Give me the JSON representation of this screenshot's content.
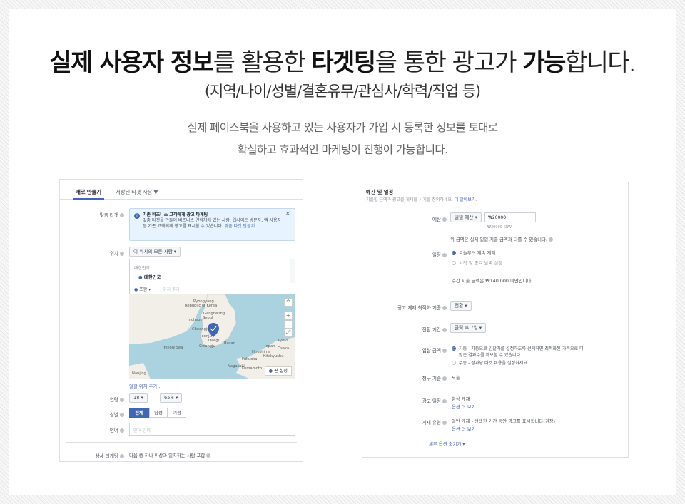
{
  "hero": {
    "headline": [
      {
        "text": "실제 사용자 정보",
        "bold": true
      },
      {
        "text": "를 활용한 ",
        "bold": false
      },
      {
        "text": "타겟팅",
        "bold": true
      },
      {
        "text": "을 통한 광고가 ",
        "bold": false
      },
      {
        "text": "가능",
        "bold": true
      },
      {
        "text": "합니다.",
        "bold": false
      }
    ],
    "subheadline": "(지역/나이/성별/결혼유무/관심사/학력/직업 등)",
    "description_line1": "실제 페이스북을 사용하고 있는 사용자가 가입 시 등록한 정보를 토대로",
    "description_line2": "확실하고 효과적인 마케팅이 진행이 가능합니다."
  },
  "left_panel": {
    "tab_new": "새로 만들기",
    "tab_saved": "저장된 타겟 사용 ▼",
    "custom_target_label": "맞춤 타겟",
    "info_title": "기존 비즈니스 고객에게 광고 타게팅",
    "info_body": "맞춤 타겟을 만들어 비즈니스 연락처에 있는 사람, 웹사이트 방문자, 앱 사용자 등 기존 고객에게 광고를 표시할 수 있습니다.",
    "info_link": "맞춤 타겟 만들기.",
    "location_label": "위치",
    "location_dropdown": "이 위치의 모든 사람 ▾",
    "location_country": "대한민국",
    "location_selected": "대한민국",
    "include_dropdown": "포함 ▾",
    "location_search_placeholder": "위치 추가",
    "map_pin_button": "핀 설정",
    "map_labels": [
      "Pyongyang",
      "Republic of Korea",
      "Gangneung",
      "Seoul",
      "Incheon",
      "Cheongju",
      "Daegu",
      "Busan",
      "Jeonju",
      "Gwangju",
      "Yellow Sea",
      "Hiroshima",
      "Japan",
      "Osaka",
      "Fukuoka",
      "Kitakyushu",
      "Kumamoto",
      "Nagasaki",
      "Kyoto",
      "Nanjing"
    ],
    "bulk_location_link": "일괄 위치 추가...",
    "age_label": "연령",
    "age_min": "18 ▾",
    "age_dash": "-",
    "age_max": "65+ ▾",
    "gender_label": "성별",
    "gender_options": [
      "전체",
      "남성",
      "여성"
    ],
    "language_label": "언어",
    "language_placeholder": "언어 입력",
    "detail_label": "상세 타게팅",
    "detail_text": "다음 중 하나 이상과 일치하는 사람 포함"
  },
  "right_panel": {
    "section_title": "예산 및 일정",
    "section_desc": "지출할 금액과 광고를 게재할 시기를 정의하세요.",
    "section_link": "더 알아보기.",
    "budget_label": "예산",
    "budget_type": "일일 예산 ▾",
    "budget_value": "₩20000",
    "budget_currency": "₩20000 KRW",
    "budget_note": "위 금액은 실제 일일 지출 금액과 다를 수 있습니다.",
    "schedule_label": "일정",
    "schedule_opt1": "오늘부터 계속 게재",
    "schedule_opt2": "시작 및 종료 날짜 설정",
    "weekly_note": "주간 지출 금액은 ₩140,000 미만입니다.",
    "optimization_label": "광고 게재 최적화 기준",
    "optimization_value": "전환 ▾",
    "window_label": "전환 기간",
    "window_value": "클릭 후 7일 ▾",
    "bid_label": "입찰 금액",
    "bid_opt1": "자동 - 자동으로 입찰가를 설정하도록 선택하면 최적화된 가격으로 더",
    "bid_opt1b": "많은 결과수를 확보할 수 있습니다.",
    "bid_opt2": "수동 - 성과당 타겟 비용을 설정하세요",
    "charge_label": "청구 기준",
    "charge_value": "노출",
    "adschedule_label": "광고 일정",
    "adschedule_value": "항상 게재",
    "adschedule_link": "옵션 더 보기",
    "delivery_label": "게재 유형",
    "delivery_value": "일반 게재 - 선택한 기간 동안 광고를 표시합니다(권장)",
    "delivery_link": "옵션 더 보기",
    "hide_options_link": "세부 옵션 숨기기 ▾"
  },
  "colors": {
    "accent": "#4267b2",
    "map_water": "#aad3df",
    "map_land": "#f2efe9"
  }
}
